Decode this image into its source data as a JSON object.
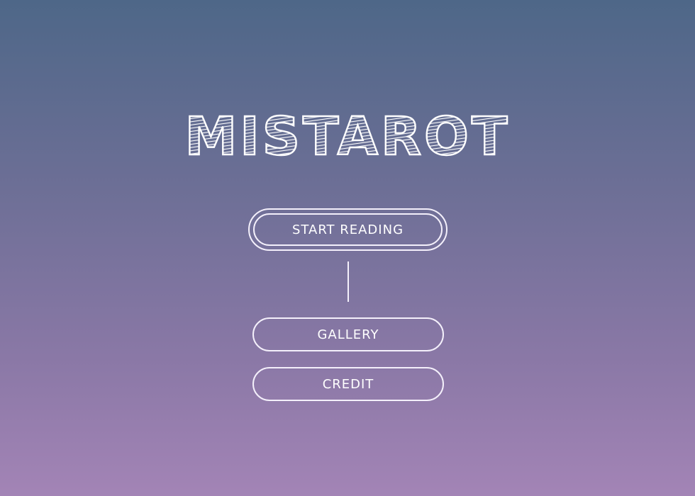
{
  "app": {
    "title": "MISTAROT"
  },
  "menu": {
    "start_label": "START READING",
    "gallery_label": "GALLERY",
    "credit_label": "CREDIT"
  },
  "colors": {
    "background_top": "#4e6788",
    "background_bottom": "#a384b6",
    "foreground": "#ffffff"
  }
}
